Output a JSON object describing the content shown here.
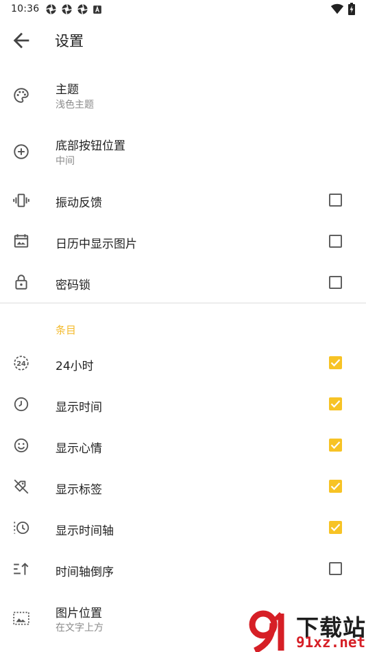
{
  "status_bar": {
    "time": "10:36",
    "notification_icons": [
      "aperture-icon",
      "aperture-icon",
      "aperture-icon",
      "a-badge-icon"
    ],
    "right_icons": [
      "wifi-icon",
      "battery-charging-icon"
    ]
  },
  "app_bar": {
    "back_icon": "arrow-back-icon",
    "title": "设置"
  },
  "settings": [
    {
      "icon": "palette-icon",
      "label": "主题",
      "sub": "浅色主题"
    },
    {
      "icon": "add-circle-icon",
      "label": "底部按钮位置",
      "sub": "中间"
    },
    {
      "icon": "vibration-icon",
      "label": "振动反馈",
      "checked": false
    },
    {
      "icon": "calendar-image-icon",
      "label": "日历中显示图片",
      "checked": false
    },
    {
      "icon": "lock-icon",
      "label": "密码锁",
      "checked": false
    }
  ],
  "entries_section": {
    "header": "条目",
    "items": [
      {
        "icon": "clock-24-icon",
        "label": "24小时",
        "checked": true
      },
      {
        "icon": "clock-icon",
        "label": "显示时间",
        "checked": true
      },
      {
        "icon": "smiley-icon",
        "label": "显示心情",
        "checked": true
      },
      {
        "icon": "label-off-icon",
        "label": "显示标签",
        "checked": true
      },
      {
        "icon": "history-icon",
        "label": "显示时间轴",
        "checked": true
      },
      {
        "icon": "sort-ascending-icon",
        "label": "时间轴倒序",
        "checked": false
      },
      {
        "icon": "image-position-icon",
        "label": "图片位置",
        "sub": "在文字上方"
      }
    ]
  },
  "watermark": {
    "top": "下载站",
    "bottom": "91xz.net"
  },
  "colors": {
    "accent": "#f7c325",
    "section_header": "#f3b92a",
    "watermark_red": "#d61f26"
  }
}
